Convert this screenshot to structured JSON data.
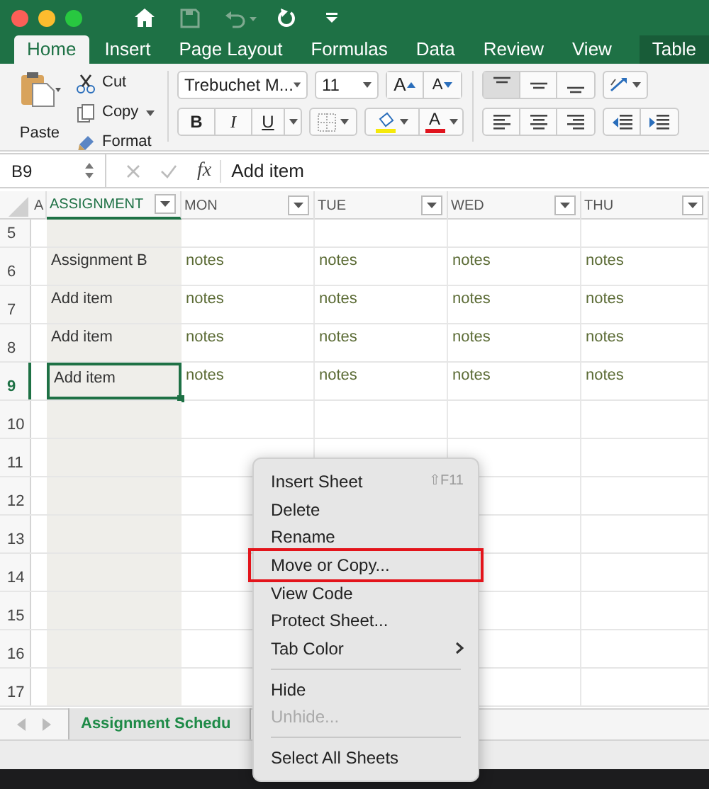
{
  "ribbon_tabs": [
    {
      "label": "Home",
      "selected": true,
      "kind": "normal"
    },
    {
      "label": "Insert",
      "selected": false,
      "kind": "normal"
    },
    {
      "label": "Page Layout",
      "selected": false,
      "kind": "normal"
    },
    {
      "label": "Formulas",
      "selected": false,
      "kind": "normal"
    },
    {
      "label": "Data",
      "selected": false,
      "kind": "normal"
    },
    {
      "label": "Review",
      "selected": false,
      "kind": "normal"
    },
    {
      "label": "View",
      "selected": false,
      "kind": "normal"
    },
    {
      "label": "Table",
      "selected": false,
      "kind": "contextual"
    }
  ],
  "clipboard": {
    "paste": "Paste",
    "cut": "Cut",
    "copy": "Copy",
    "format": "Format"
  },
  "font": {
    "name": "Trebuchet M...",
    "size": "11",
    "grow": "A",
    "shrink": "A",
    "bold": "B",
    "italic": "I",
    "underline": "U",
    "font_color": "A"
  },
  "formula_bar": {
    "name_box": "B9",
    "fx": "fx",
    "value": "Add item"
  },
  "columns": [
    {
      "label": "A",
      "filter": false,
      "selected": false
    },
    {
      "label": "ASSIGNMENT",
      "filter": true,
      "selected": true
    },
    {
      "label": "MON",
      "filter": true,
      "selected": false
    },
    {
      "label": "TUE",
      "filter": true,
      "selected": false
    },
    {
      "label": "WED",
      "filter": true,
      "selected": false
    },
    {
      "label": "THU",
      "filter": true,
      "selected": false
    }
  ],
  "rows": [
    {
      "number": "5",
      "selected": false,
      "cells": []
    },
    {
      "number": "6",
      "selected": false,
      "cells": [
        "Assignment B",
        "notes",
        "notes",
        "notes",
        "notes"
      ]
    },
    {
      "number": "7",
      "selected": false,
      "cells": [
        "Add item",
        "notes",
        "notes",
        "notes",
        "notes"
      ]
    },
    {
      "number": "8",
      "selected": false,
      "cells": [
        "Add item",
        "notes",
        "notes",
        "notes",
        "notes"
      ]
    },
    {
      "number": "9",
      "selected": true,
      "cells": [
        "Add item",
        "notes",
        "notes",
        "notes",
        "notes"
      ]
    },
    {
      "number": "10",
      "selected": false,
      "cells": []
    },
    {
      "number": "11",
      "selected": false,
      "cells": []
    },
    {
      "number": "12",
      "selected": false,
      "cells": []
    },
    {
      "number": "13",
      "selected": false,
      "cells": []
    },
    {
      "number": "14",
      "selected": false,
      "cells": []
    },
    {
      "number": "15",
      "selected": false,
      "cells": []
    },
    {
      "number": "16",
      "selected": false,
      "cells": []
    },
    {
      "number": "17",
      "selected": false,
      "cells": []
    }
  ],
  "sheet_tabs": [
    {
      "label": "Assignment Schedu",
      "selected": true
    }
  ],
  "context_menu": {
    "items": [
      {
        "kind": "item",
        "label": "Insert Sheet",
        "shortcut": "⇧F11",
        "disabled": false,
        "highlighted": false,
        "submenu": false
      },
      {
        "kind": "item",
        "label": "Delete",
        "disabled": false,
        "highlighted": false,
        "submenu": false
      },
      {
        "kind": "item",
        "label": "Rename",
        "disabled": false,
        "highlighted": false,
        "submenu": false
      },
      {
        "kind": "item",
        "label": "Move or Copy...",
        "disabled": false,
        "highlighted": true,
        "submenu": false
      },
      {
        "kind": "item",
        "label": "View Code",
        "disabled": false,
        "highlighted": false,
        "submenu": false
      },
      {
        "kind": "item",
        "label": "Protect Sheet...",
        "disabled": false,
        "highlighted": false,
        "submenu": false
      },
      {
        "kind": "item",
        "label": "Tab Color",
        "disabled": false,
        "highlighted": false,
        "submenu": true
      },
      {
        "kind": "separator"
      },
      {
        "kind": "item",
        "label": "Hide",
        "disabled": false,
        "highlighted": false,
        "submenu": false
      },
      {
        "kind": "item",
        "label": "Unhide...",
        "disabled": true,
        "highlighted": false,
        "submenu": false
      },
      {
        "kind": "separator"
      },
      {
        "kind": "item",
        "label": "Select All Sheets",
        "disabled": false,
        "highlighted": false,
        "submenu": false
      }
    ]
  }
}
